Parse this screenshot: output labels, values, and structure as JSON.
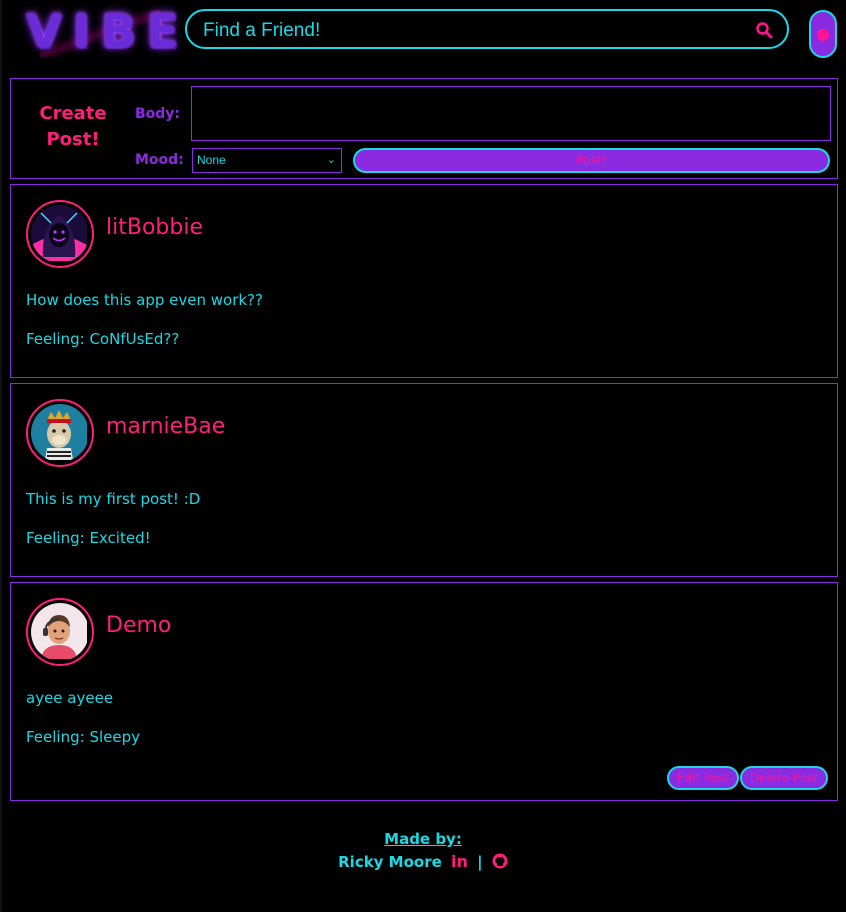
{
  "header": {
    "logo": "VIBE",
    "search_placeholder": "Find a Friend!"
  },
  "create_post": {
    "title_line1": "Create",
    "title_line2": "Post!",
    "body_label": "Body:",
    "mood_label": "Mood:",
    "mood_selected": "None",
    "post_button": "Post!"
  },
  "posts": [
    {
      "username": "litBobbie",
      "body": "How does this app even work??",
      "mood": "Feeling: CoNfUsEd??"
    },
    {
      "username": "marnieBae",
      "body": "This is my first post! :D",
      "mood": "Feeling: Excited!"
    },
    {
      "username": "Demo",
      "body": "ayee ayeee",
      "mood": "Feeling: Sleepy",
      "edit_label": "Edit Post",
      "delete_label": "Delete Post"
    }
  ],
  "footer": {
    "made_by": "Made by:",
    "author": "Ricky Moore",
    "separator": "|"
  },
  "colors": {
    "background": "#000000",
    "cyan": "#18d9e6",
    "purple": "#8a2be2",
    "pink": "#ff1f7a"
  }
}
